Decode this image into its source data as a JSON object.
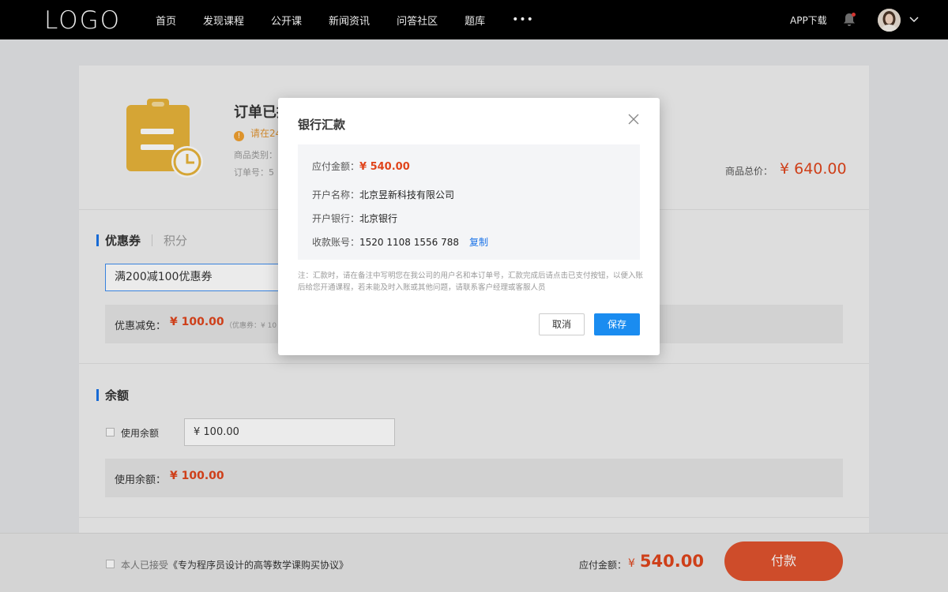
{
  "header": {
    "logo": "LOGO",
    "nav": [
      "首页",
      "发现课程",
      "公开课",
      "新闻资讯",
      "问答社区",
      "题库"
    ],
    "more": "•••",
    "app_download": "APP下载"
  },
  "order": {
    "title": "订单已提",
    "warning": "请在24",
    "category_label": "商品类别：",
    "order_no_label": "订单号：5",
    "total_label": "商品总价：",
    "total_value": "¥ 640.00"
  },
  "coupon_section": {
    "tab_active": "优惠券",
    "tab_inactive": "积分",
    "selected": "满200减100优惠券",
    "discount_label": "优惠减免：",
    "discount_value": "¥ 100.00",
    "discount_note": "（优惠券：¥ 10"
  },
  "balance_section": {
    "title": "余额",
    "use_label": "使用余额",
    "input_value": "¥ 100.00",
    "used_label": "使用余额：",
    "used_value": "¥ 100.00"
  },
  "footer": {
    "agree_prefix": "本人已接受",
    "agree_link": "《专为程序员设计的高等数学课购买协议》",
    "pay_label": "应付金额：",
    "pay_currency": "¥",
    "pay_value": "540.00",
    "pay_button": "付款"
  },
  "modal": {
    "title": "银行汇款",
    "amount_label": "应付金额：",
    "amount_value": "¥ 540.00",
    "account_name_label": "开户名称：",
    "account_name_value": "北京昱新科技有限公司",
    "bank_label": "开户银行：",
    "bank_value": "北京银行",
    "account_no_label": "收款账号：",
    "account_no_value": "1520 1108 1556 788",
    "copy_label": "复制",
    "note": "注：汇款时，请在备注中写明您在我公司的用户名和本订单号，汇款完成后请点击已支付按钮，以便入账后给您开通课程，若未能及时入账或其他问题，请联系客户经理或客服人员",
    "cancel_label": "取消",
    "save_label": "保存"
  },
  "colors": {
    "accent_blue": "#1a8cf0",
    "price_red": "#e0451c",
    "pay_button": "#e0532e",
    "warning_orange": "#f0a030",
    "icon_gold": "#e8b43a"
  }
}
